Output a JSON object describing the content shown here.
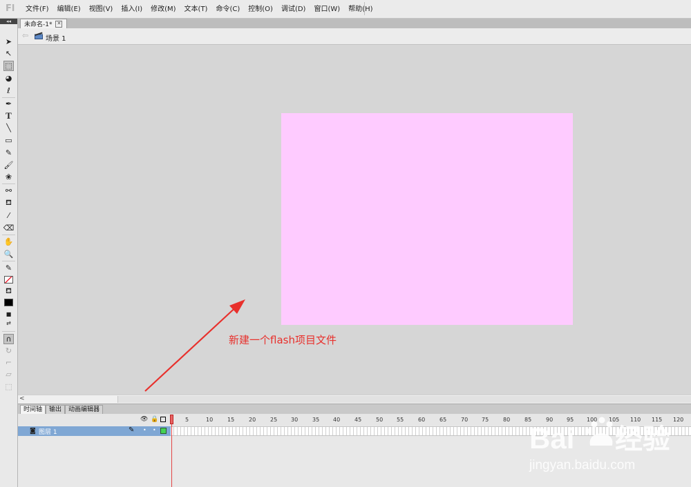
{
  "app": {
    "logo": "Fl"
  },
  "menu": [
    "文件(F)",
    "编辑(E)",
    "视图(V)",
    "插入(I)",
    "修改(M)",
    "文本(T)",
    "命令(C)",
    "控制(O)",
    "调试(D)",
    "窗口(W)",
    "帮助(H)"
  ],
  "document": {
    "tab_label": "未命名-1*",
    "close_glyph": "✕"
  },
  "scene": {
    "label": "场景 1"
  },
  "stage": {
    "color": "#fecbff"
  },
  "annotation": {
    "text": "新建一个flash项目文件",
    "color": "#e8302c"
  },
  "bottom_panel": {
    "tabs": [
      "时间轴",
      "输出",
      "动画编辑器"
    ]
  },
  "timeline": {
    "ruler_numbers": [
      "1",
      "5",
      "10",
      "15",
      "20",
      "25",
      "30",
      "35",
      "40",
      "45",
      "50",
      "55",
      "60",
      "65",
      "70",
      "75",
      "80",
      "85",
      "90",
      "95",
      "100",
      "105",
      "110",
      "115",
      "120"
    ],
    "layer": {
      "name": "图层 1"
    }
  },
  "watermark": {
    "brand": "Baidu 经验",
    "url": "jingyan.baidu.com"
  }
}
